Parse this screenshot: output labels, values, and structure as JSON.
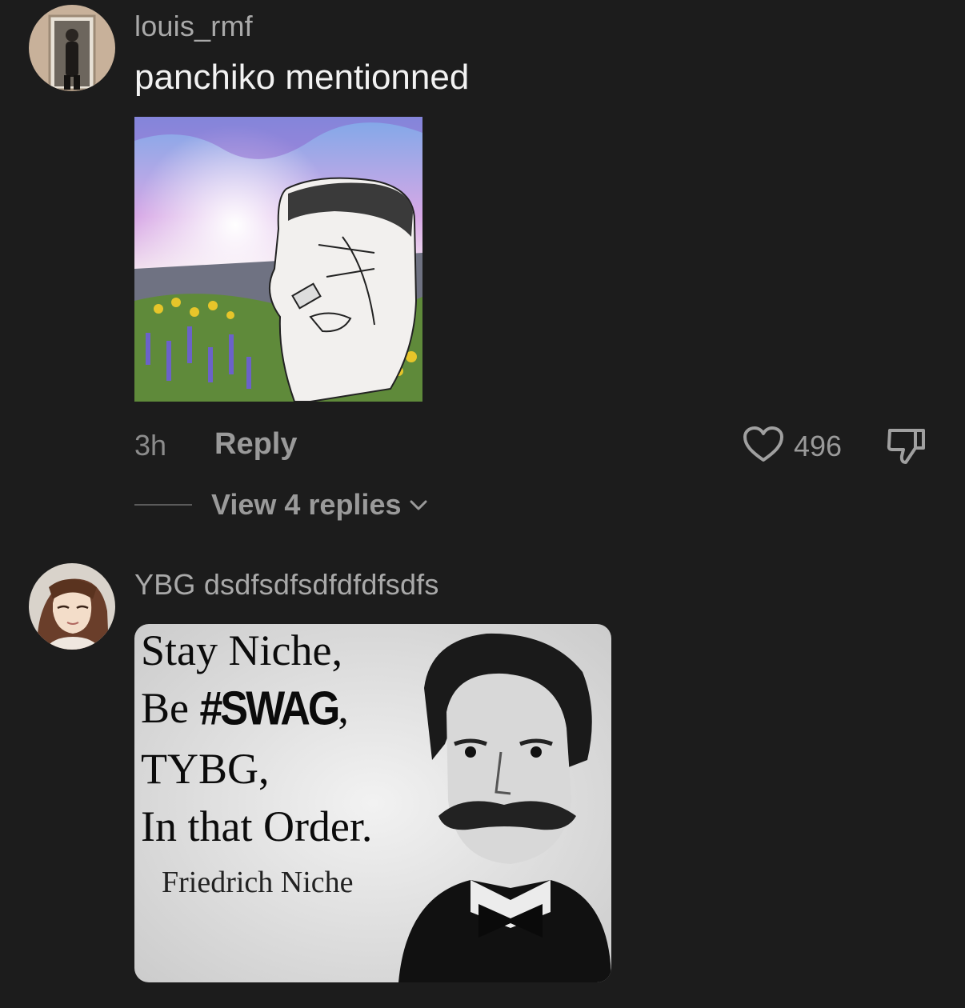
{
  "comments": [
    {
      "username": "louis_rmf",
      "text": "panchiko mentionned",
      "time": "3h",
      "reply_label": "Reply",
      "likes": "496",
      "view_replies": "View 4 replies"
    },
    {
      "username": "YBG dsdfsdfsdfdfdfsdfs",
      "meme_lines": [
        "Stay Niche,",
        "Be",
        "#SWAG",
        ",",
        "TYBG,",
        "In that Order."
      ],
      "meme_attribution": "Friedrich Niche"
    }
  ],
  "icons": {
    "like": "heart-icon",
    "dislike": "thumbs-down-icon",
    "expand": "chevron-down-icon"
  },
  "colors": {
    "background": "#1c1c1c",
    "username": "#a9a9a9",
    "text": "#f2f2f2",
    "muted": "#9a9a9a"
  }
}
